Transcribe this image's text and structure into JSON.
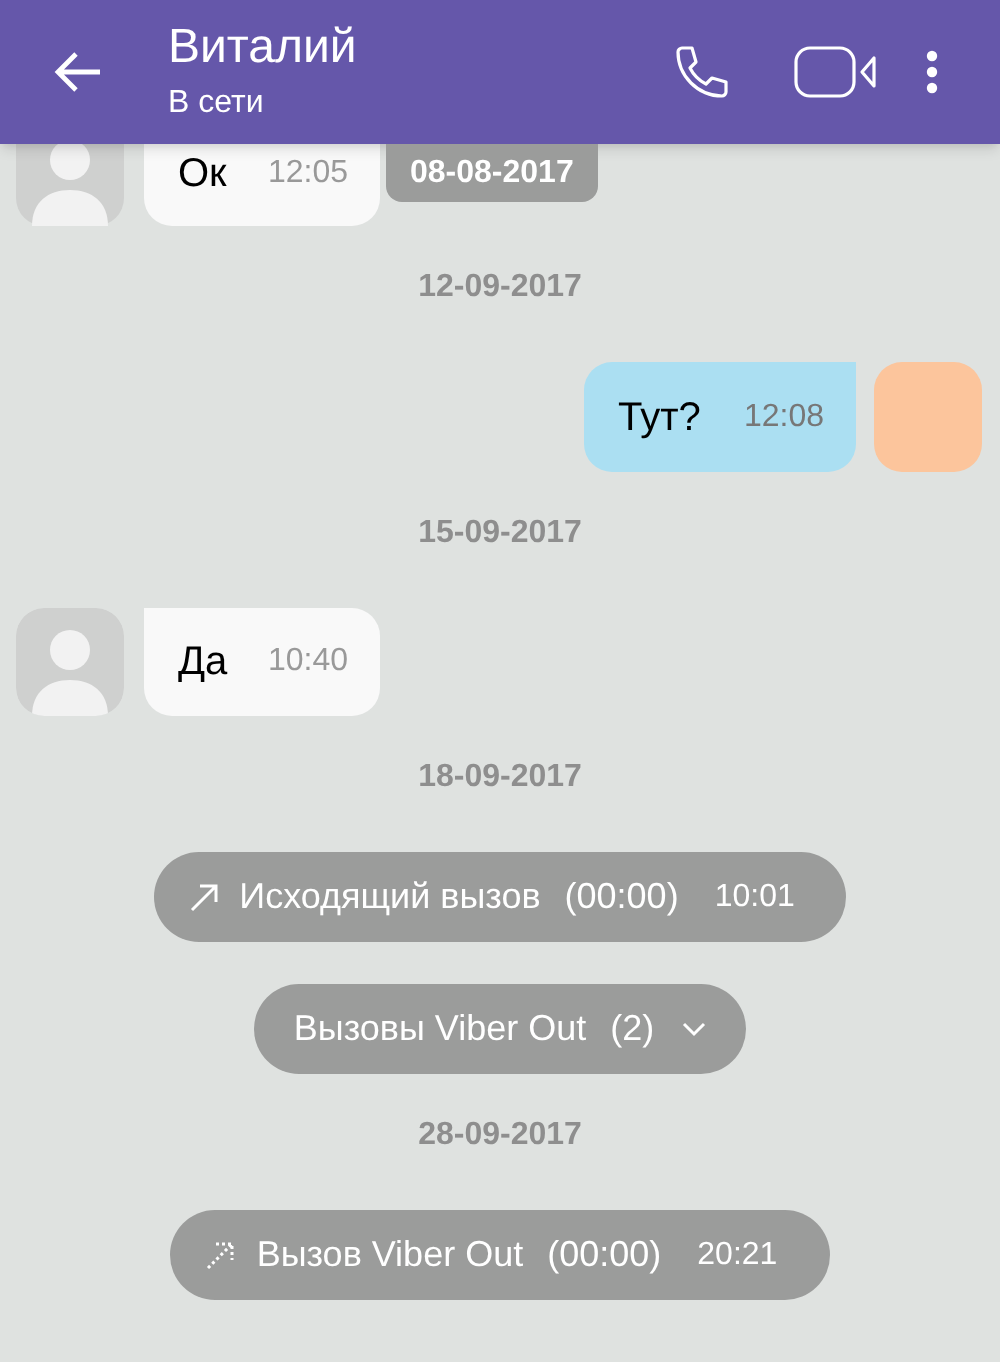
{
  "header": {
    "contact_name": "Виталий",
    "status": "В сети"
  },
  "sticky_date": "08-08-2017",
  "messages": [
    {
      "kind": "incoming",
      "text": "Ок",
      "time": "12:05"
    },
    {
      "kind": "date",
      "text": "12-09-2017"
    },
    {
      "kind": "outgoing",
      "text": "Тут?",
      "time": "12:08"
    },
    {
      "kind": "date",
      "text": "15-09-2017"
    },
    {
      "kind": "incoming",
      "text": "Да",
      "time": "10:40"
    },
    {
      "kind": "date",
      "text": "18-09-2017"
    },
    {
      "kind": "call",
      "text": "Исходящий вызов",
      "duration": "(00:00)",
      "time": "10:01"
    },
    {
      "kind": "call_group",
      "text": "Вызовы Viber Out",
      "count": "(2)",
      "expanded": false
    },
    {
      "kind": "date",
      "text": "28-09-2017"
    },
    {
      "kind": "viber_out_call",
      "text": "Вызов Viber Out",
      "duration": "(00:00)",
      "time": "20:21"
    }
  ]
}
